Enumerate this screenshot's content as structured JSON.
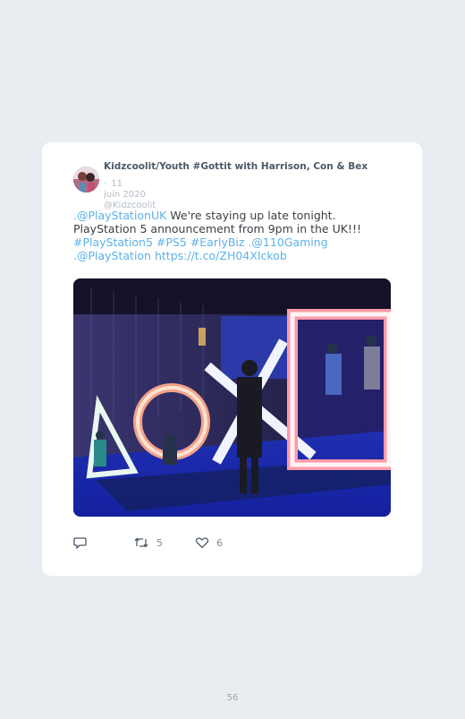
{
  "tweet": {
    "author_name": "Kidzcoolit/Youth #Gottit with Harrison, Con & Bex",
    "separator": "·",
    "date_part1": "11",
    "date_part2": "juin 2020",
    "handle": "@Kidzcoolit",
    "text_segments": [
      {
        "text": ".@PlayStationUK",
        "link": true
      },
      {
        "text": " We're staying up late tonight. PlayStation 5 announcement from 9pm in the UK!!! ",
        "link": false
      },
      {
        "text": "#PlayStation5",
        "link": true
      },
      {
        "text": " ",
        "link": false
      },
      {
        "text": "#PS5",
        "link": true
      },
      {
        "text": " ",
        "link": false
      },
      {
        "text": "#EarlyBiz",
        "link": true
      },
      {
        "text": " ",
        "link": false
      },
      {
        "text": ".@110Gaming",
        "link": true
      },
      {
        "text": " ",
        "link": false
      },
      {
        "text": ".@PlayStation",
        "link": true
      },
      {
        "text": " ",
        "link": false
      },
      {
        "text": "https://t.co/ZH04XIckob",
        "link": true
      }
    ],
    "retweet_count": "5",
    "like_count": "6"
  },
  "colors": {
    "link": "#5cb1e8",
    "icon": "#4a5a6a",
    "background": "#e9edf1"
  },
  "icons": [
    "reply-icon",
    "retweet-icon",
    "like-icon"
  ],
  "page_number": "56"
}
